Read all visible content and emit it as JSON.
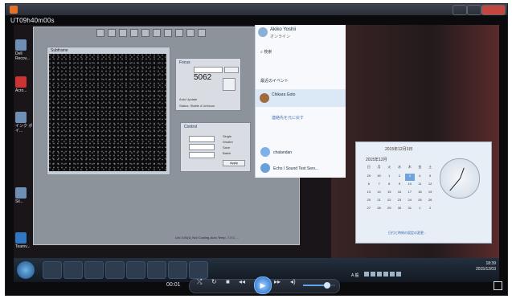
{
  "window": {
    "title": "UT09h40m00s"
  },
  "desktop_icons": [
    "Dell Recov...",
    "Acro...",
    "インク ポイ...",
    "Sil...",
    "Teamv..."
  ],
  "camera_window": {
    "title": "Subframe"
  },
  "focus_panel": {
    "title": "Focus",
    "value": "5062",
    "checkbox_label": "Auto Update",
    "status": "Status: Stable 4 Unfocus"
  },
  "control_panel": {
    "title": "Control",
    "options": [
      "Single",
      "Shutter",
      "Save",
      "Batch"
    ],
    "apply_label": "Apply"
  },
  "status_bar": "Lifo 3:04(1)  Not Cooling-Auto  Temp -7.5 C ...",
  "chat": {
    "user_name": "Akiko Yoshii",
    "user_status": "オンライン",
    "search_label": "検索",
    "recent_label": "最近のイベント",
    "selected_contact": "Chikara Goto",
    "tasks_label": "連絡先を元に戻す",
    "contact2": "chalandan",
    "contact3": "Echo / Sound Test Serv..."
  },
  "calendar": {
    "header": "2015年12月3日",
    "month": "2015年12月",
    "days": [
      "日",
      "月",
      "火",
      "水",
      "木",
      "金",
      "土",
      "29",
      "30",
      "1",
      "2",
      "3",
      "4",
      "5",
      "6",
      "7",
      "8",
      "9",
      "10",
      "11",
      "12",
      "13",
      "14",
      "15",
      "16",
      "17",
      "18",
      "19",
      "20",
      "21",
      "22",
      "23",
      "24",
      "25",
      "26",
      "27",
      "28",
      "29",
      "30",
      "31",
      "1",
      "2"
    ],
    "link": "日付と時刻の設定の変更..."
  },
  "taskbar": {
    "time": "18:39",
    "date": "2015/12/03",
    "ime": "A 般"
  },
  "player": {
    "elapsed": "00:01",
    "volume": 0.75
  },
  "colors": {
    "accent": "#1d67c4",
    "taskbar": "#121922"
  },
  "icons": [
    "app-icon",
    "start-orb",
    "ie-icon",
    "folder-icon",
    "media-icon",
    "play-icon",
    "shuffle-icon",
    "repeat-icon",
    "stop-icon",
    "prev-icon",
    "next-icon",
    "volume-icon",
    "fullscreen-icon"
  ]
}
